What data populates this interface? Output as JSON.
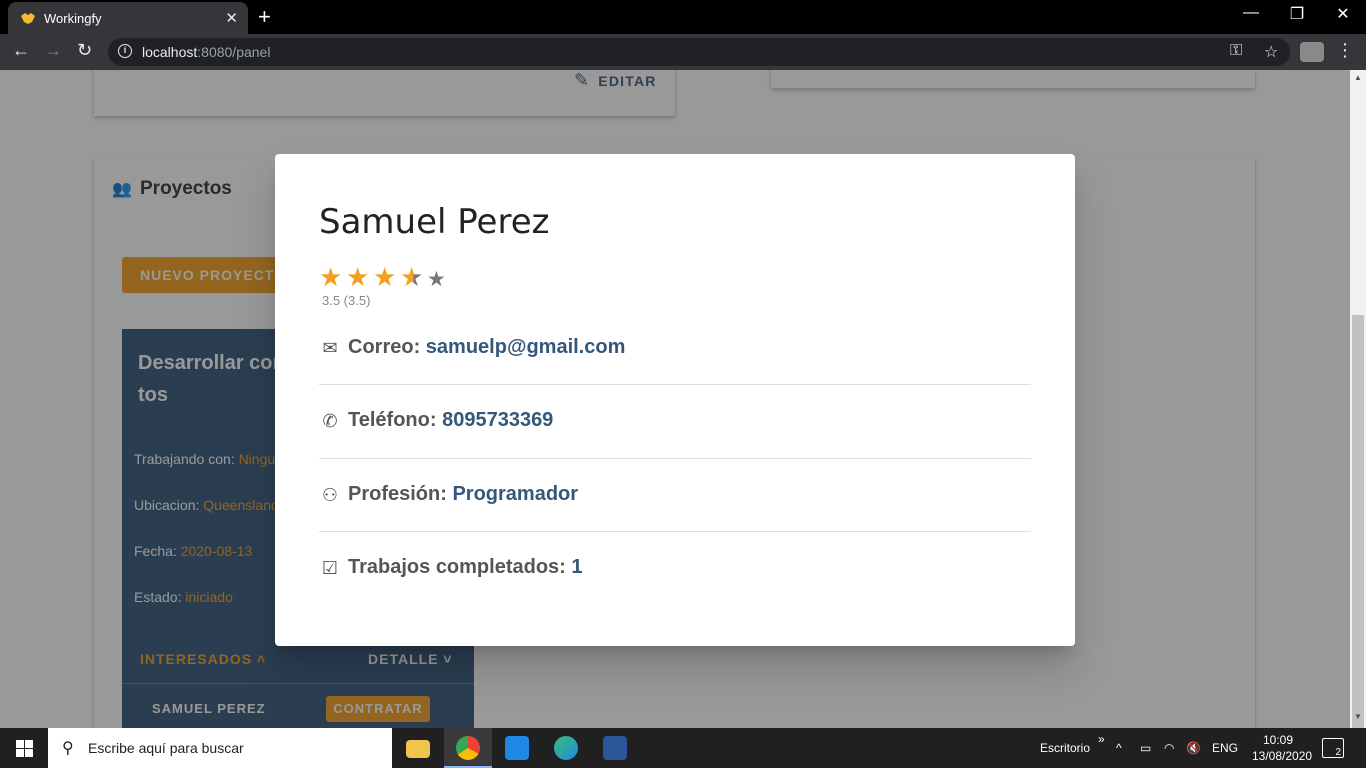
{
  "browser": {
    "tab_title": "Workingfy",
    "url_host": "localhost",
    "url_rest": ":8080/panel"
  },
  "page": {
    "edit_label": "EDITAR",
    "projects_title": "Proyectos",
    "new_project_label": "NUEVO PROYECTO",
    "project_card": {
      "title_line1": "Desarrollar con",
      "title_line2": "tos",
      "working_with_label": "Trabajando con:",
      "working_with_value": "Ningu",
      "location_label": "Ubicacion:",
      "location_value": "Queensland",
      "date_label": "Fecha:",
      "date_value": "2020-08-13",
      "status_label": "Estado:",
      "status_value": "iniciado",
      "interested_label": "INTERESADOS",
      "detail_label": "DETALLE",
      "interested_name": "SAMUEL PEREZ",
      "hire_label": "CONTRATAR"
    }
  },
  "dialog": {
    "name": "Samuel Perez",
    "rating": 3.5,
    "rating_max": 5,
    "rating_text": "3.5 (3.5)",
    "email_label": "Correo:",
    "email_value": "samuelp@gmail.com",
    "phone_label": "Teléfono:",
    "phone_value": "8095733369",
    "profession_label": "Profesión:",
    "profession_value": "Programador",
    "completed_label": "Trabajos completados:",
    "completed_value": "1"
  },
  "taskbar": {
    "search_placeholder": "Escribe aquí para buscar",
    "desktop_label": "Escritorio",
    "lang": "ENG",
    "time": "10:09",
    "date": "13/08/2020",
    "notifications": "2"
  },
  "colors": {
    "accent": "#f59f1e",
    "primary": "#35577a"
  }
}
